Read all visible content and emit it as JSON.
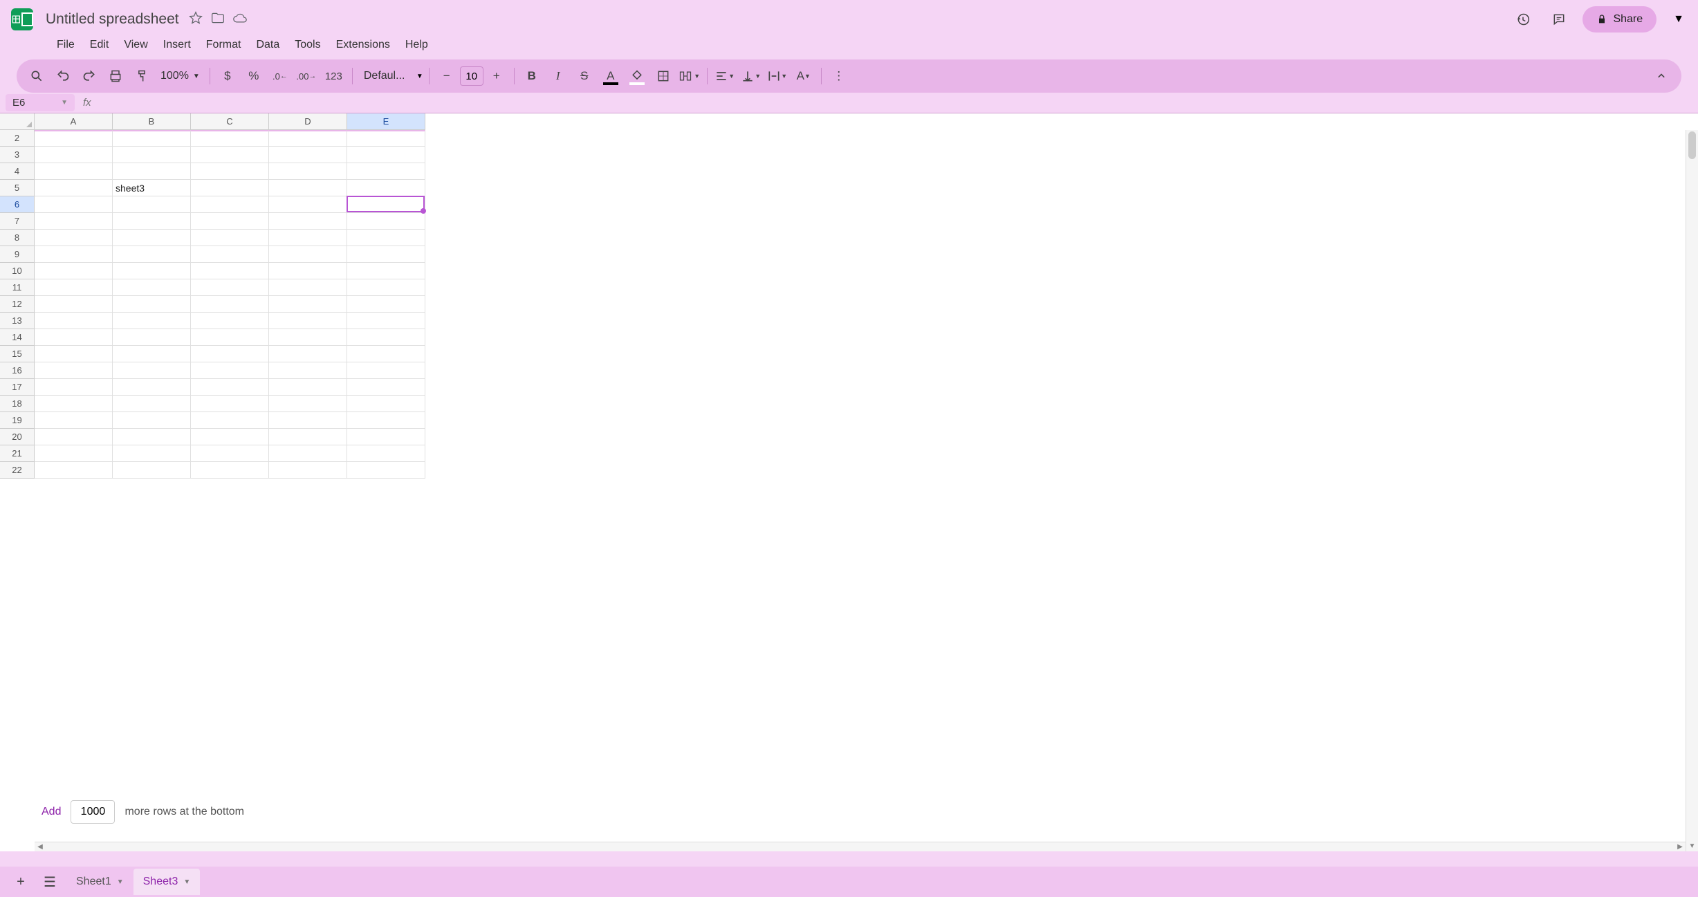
{
  "doc": {
    "title": "Untitled spreadsheet"
  },
  "menus": [
    "File",
    "Edit",
    "View",
    "Insert",
    "Format",
    "Data",
    "Tools",
    "Extensions",
    "Help"
  ],
  "toolbar": {
    "zoom": "100%",
    "font": "Defaul...",
    "font_size": "10",
    "format_123": "123"
  },
  "share": {
    "label": "Share"
  },
  "namebox": {
    "value": "E6"
  },
  "formula": {
    "value": ""
  },
  "columns": [
    "A",
    "B",
    "C",
    "D",
    "E"
  ],
  "rows": [
    2,
    3,
    4,
    5,
    6,
    7,
    8,
    9,
    10,
    11,
    12,
    13,
    14,
    15,
    16,
    17,
    18,
    19,
    20,
    21,
    22
  ],
  "selected": {
    "col": "E",
    "row": 6,
    "col_index": 4,
    "row_index": 4
  },
  "cells": {
    "B5": "sheet3"
  },
  "add_rows": {
    "label": "Add",
    "count": "1000",
    "suffix": "more rows at the bottom"
  },
  "sheets": [
    {
      "name": "Sheet1",
      "active": false
    },
    {
      "name": "Sheet3",
      "active": true
    }
  ]
}
